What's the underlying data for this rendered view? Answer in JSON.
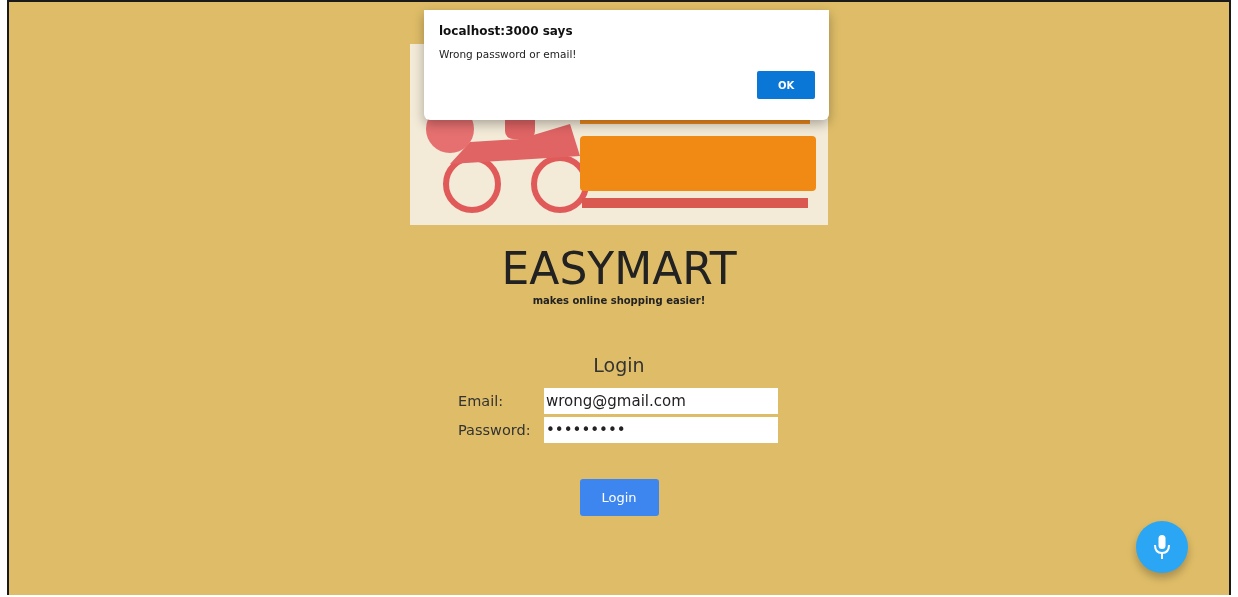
{
  "dialog": {
    "title": "localhost:3000 says",
    "message": "Wrong password or email!",
    "button": "OK"
  },
  "brand": {
    "title": "EASYMART",
    "tagline": "makes online shopping easier!"
  },
  "login": {
    "heading": "Login",
    "fields": [
      {
        "label": "Email:",
        "value": "wrong@gmail.com"
      },
      {
        "label": "Password:",
        "value": "•••••••••"
      }
    ],
    "button": "Login"
  },
  "voice_button": {
    "kind": "microphone"
  }
}
